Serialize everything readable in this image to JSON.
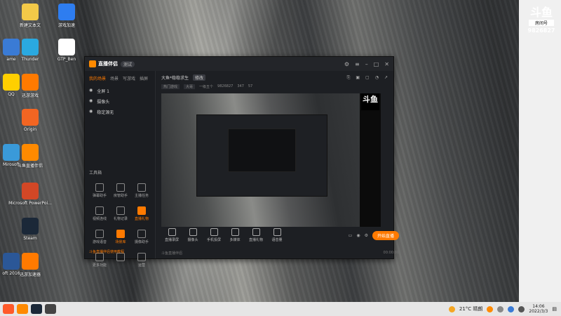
{
  "desktop_icons": [
    {
      "label": "新建文本文",
      "color": "#f3c948"
    },
    {
      "label": "游戏加速",
      "color": "#2e7df0"
    },
    {
      "label": "ame",
      "color": "#3a7bd5"
    },
    {
      "label": "Thunder",
      "color": "#2aa9e0"
    },
    {
      "label": "GTP_Ben",
      "color": "#ffffff"
    },
    {
      "label": "QQ",
      "color": "#ffcf00"
    },
    {
      "label": "迅游游戏",
      "color": "#ff7a00"
    },
    {
      "label": "Origin",
      "color": "#f26522"
    },
    {
      "label": "Mirosoft",
      "color": "#3a9ad9"
    },
    {
      "label": "斗鱼直播伴侣",
      "color": "#ff8a00"
    },
    {
      "label": "Microsoft PowerPoi...",
      "color": "#d24726"
    },
    {
      "label": "Steam",
      "color": "#1b2838"
    },
    {
      "label": "oft 2016",
      "color": "#2b5797"
    },
    {
      "label": "迅游加速器",
      "color": "#ff7a00"
    }
  ],
  "top_right_logo": {
    "mark": "斗鱼",
    "label": "房间号",
    "room_no": "9826827"
  },
  "app": {
    "title": "直播伴侣",
    "version": "测试",
    "sidebar_tabs": [
      "我的场景",
      "场景",
      "写游戏",
      "插屏"
    ],
    "scenes": [
      "全屏 1",
      "摄像头",
      "稳定源无"
    ],
    "tools_title": "工具箱",
    "tools": [
      "弹幕助手",
      "房管助手",
      "主播任务",
      "视频连线",
      "礼物记录",
      "直播礼物",
      "游戏语音",
      "场景库",
      "摄像助手",
      "更多功能",
      "",
      "运营"
    ],
    "sidebar_footer": "斗鱼直播伴侣使用教程",
    "room_title": "大鱼*稳稳求生",
    "room_badge": "修改",
    "info_chips": [
      "热门游戏",
      "大哥"
    ],
    "info_text": [
      "一级五个",
      "9826827",
      "347",
      "57"
    ],
    "preview_logo": "斗鱼",
    "controls": [
      "直播录屏",
      "摄像头",
      "手机投屏",
      "多媒体",
      "直播礼物",
      "语音量"
    ],
    "start_button": "开始直播",
    "status_left": "斗鱼直播伴侣",
    "status_right": "00:00:00"
  },
  "taskbar": {
    "weather": "21°C 晴朗",
    "time": "14:06",
    "date": "2022/3/3"
  }
}
